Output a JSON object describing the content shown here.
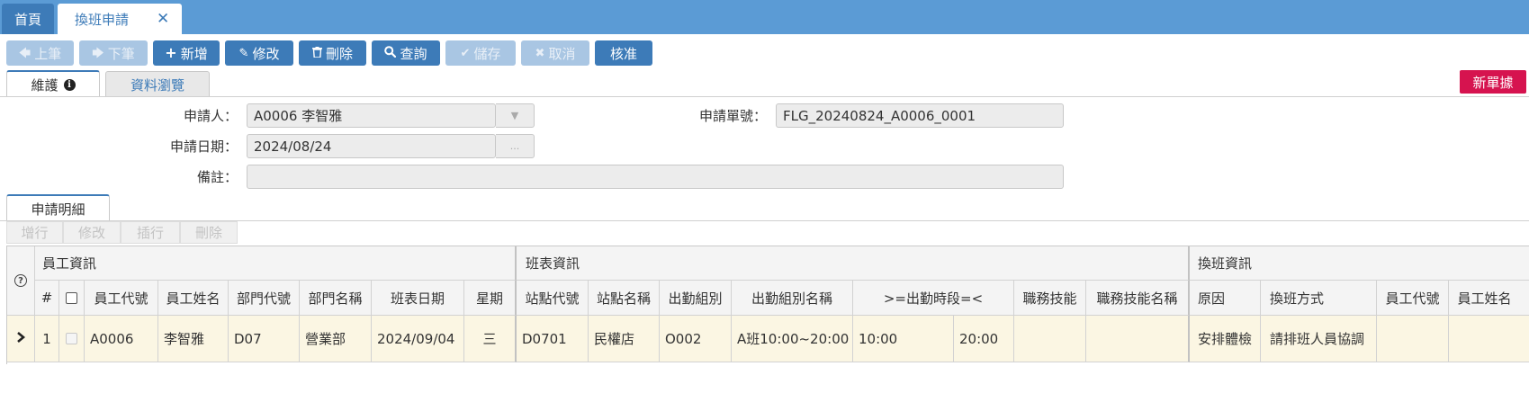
{
  "tabs": {
    "home": "首頁",
    "active": "換班申請"
  },
  "toolbar": [
    {
      "key": "prev",
      "icon": "arrow-left-icon",
      "label": "上筆",
      "enabled": false
    },
    {
      "key": "next",
      "icon": "arrow-right-icon",
      "label": "下筆",
      "enabled": false
    },
    {
      "key": "add",
      "icon": "plus-icon",
      "label": "新增",
      "enabled": true
    },
    {
      "key": "edit",
      "icon": "pencil-icon",
      "label": "修改",
      "enabled": true
    },
    {
      "key": "delete",
      "icon": "trash-icon",
      "label": "刪除",
      "enabled": true
    },
    {
      "key": "query",
      "icon": "search-icon",
      "label": "查詢",
      "enabled": true
    },
    {
      "key": "save",
      "icon": "check-icon",
      "label": "儲存",
      "enabled": false
    },
    {
      "key": "cancel",
      "icon": "x-icon",
      "label": "取消",
      "enabled": false
    },
    {
      "key": "approve",
      "icon": "",
      "label": "核准",
      "enabled": true
    }
  ],
  "form_tabs": {
    "maintain": "維護",
    "browse": "資料瀏覽"
  },
  "new_doc_badge": "新單據",
  "form": {
    "applicant_label": "申請人：",
    "applicant_value": "A0006 李智雅",
    "apply_no_label": "申請單號：",
    "apply_no_value": "FLG_20240824_A0006_0001",
    "apply_date_label": "申請日期：",
    "apply_date_value": "2024/08/24",
    "date_button": "...",
    "remark_label": "備註：",
    "remark_value": ""
  },
  "detail": {
    "tab": "申請明細",
    "buttons": {
      "add_row": "增行",
      "edit": "修改",
      "insert": "插行",
      "delete": "刪除"
    }
  },
  "grid": {
    "groups": {
      "employee": "員工資訊",
      "schedule": "班表資訊",
      "swap": "換班資訊"
    },
    "headers": {
      "no": "#",
      "emp_id": "員工代號",
      "emp_name": "員工姓名",
      "dept_id": "部門代號",
      "dept_name": "部門名稱",
      "sched_date": "班表日期",
      "weekday": "星期",
      "site_id": "站點代號",
      "site_name": "站點名稱",
      "group": "出勤組別",
      "group_name": "出勤組別名稱",
      "period": ">=出勤時段=<",
      "skill": "職務技能",
      "skill_name": "職務技能名稱",
      "reason": "原因",
      "method": "換班方式",
      "swap_emp_id": "員工代號",
      "swap_emp_name": "員工姓名"
    },
    "rows": [
      {
        "no": "1",
        "emp_id": "A0006",
        "emp_name": "李智雅",
        "dept_id": "D07",
        "dept_name": "營業部",
        "sched_date": "2024/09/04",
        "weekday": "三",
        "site_id": "D0701",
        "site_name": "民權店",
        "group": "O002",
        "group_name": "A班10:00~20:00",
        "period_from": "10:00",
        "period_to": "20:00",
        "skill": "",
        "skill_name": "",
        "reason": "安排體檢",
        "method": "請排班人員協調",
        "swap_emp_id": "",
        "swap_emp_name": ""
      }
    ]
  }
}
